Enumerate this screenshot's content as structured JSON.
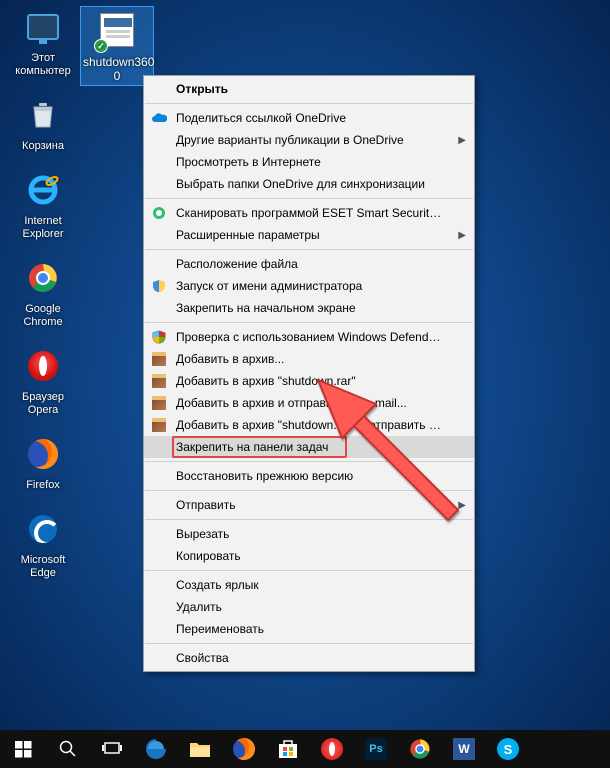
{
  "desktop": {
    "icons": [
      {
        "id": "this-pc",
        "label": "Этот\nкомпьютер"
      },
      {
        "id": "recycle-bin",
        "label": "Корзина"
      },
      {
        "id": "internet-explorer",
        "label": "Internet\nExplorer"
      },
      {
        "id": "google-chrome",
        "label": "Google\nChrome"
      },
      {
        "id": "opera",
        "label": "Браузер\nOpera"
      },
      {
        "id": "firefox",
        "label": "Firefox"
      },
      {
        "id": "microsoft-edge",
        "label": "Microsoft\nEdge"
      }
    ],
    "selected": {
      "id": "shutdown3600",
      "label": "shutdown360\n0"
    }
  },
  "context_menu": {
    "items": [
      {
        "label": "Открыть",
        "bold": true,
        "noicon": true
      },
      {
        "sep": true
      },
      {
        "label": "Поделиться ссылкой OneDrive",
        "icon": "onedrive"
      },
      {
        "label": "Другие варианты публикации в OneDrive",
        "arrow": true,
        "noicon": true
      },
      {
        "label": "Просмотреть в Интернете",
        "noicon": true
      },
      {
        "label": "Выбрать папки OneDrive для синхронизации",
        "noicon": true
      },
      {
        "sep": true
      },
      {
        "label": "Сканировать программой ESET Smart Security Premium",
        "icon": "eset"
      },
      {
        "label": "Расширенные параметры",
        "arrow": true,
        "noicon": true
      },
      {
        "sep": true
      },
      {
        "label": "Расположение файла",
        "noicon": true
      },
      {
        "label": "Запуск от имени администратора",
        "icon": "shield"
      },
      {
        "label": "Закрепить на начальном экране",
        "noicon": true
      },
      {
        "sep": true
      },
      {
        "label": "Проверка с использованием Windows Defender...",
        "icon": "defender"
      },
      {
        "label": "Добавить в архив...",
        "icon": "winrar"
      },
      {
        "label": "Добавить в архив \"shutdown.rar\"",
        "icon": "winrar"
      },
      {
        "label": "Добавить в архив и отправить по e-mail...",
        "icon": "winrar"
      },
      {
        "label": "Добавить в архив \"shutdown.rar\" и отправить по e-mail",
        "icon": "winrar"
      },
      {
        "label": "Закрепить на панели задач",
        "noicon": true,
        "highlight": true
      },
      {
        "sep": true
      },
      {
        "label": "Восстановить прежнюю версию",
        "noicon": true
      },
      {
        "sep": true
      },
      {
        "label": "Отправить",
        "arrow": true,
        "noicon": true
      },
      {
        "sep": true
      },
      {
        "label": "Вырезать",
        "noicon": true
      },
      {
        "label": "Копировать",
        "noicon": true
      },
      {
        "sep": true
      },
      {
        "label": "Создать ярлык",
        "noicon": true
      },
      {
        "label": "Удалить",
        "noicon": true
      },
      {
        "label": "Переименовать",
        "noicon": true
      },
      {
        "sep": true
      },
      {
        "label": "Свойства",
        "noicon": true
      }
    ],
    "highlight_width": 175
  },
  "taskbar": {
    "items": [
      {
        "id": "start",
        "icon": "windows"
      },
      {
        "id": "search",
        "icon": "search"
      },
      {
        "id": "taskview",
        "icon": "taskview"
      },
      {
        "id": "edge",
        "icon": "edge"
      },
      {
        "id": "explorer",
        "icon": "explorer"
      },
      {
        "id": "firefox",
        "icon": "firefox"
      },
      {
        "id": "store",
        "icon": "store"
      },
      {
        "id": "opera",
        "icon": "opera"
      },
      {
        "id": "photoshop",
        "icon": "photoshop"
      },
      {
        "id": "chrome",
        "icon": "chrome"
      },
      {
        "id": "word",
        "icon": "word"
      },
      {
        "id": "skype",
        "icon": "skype"
      }
    ]
  }
}
